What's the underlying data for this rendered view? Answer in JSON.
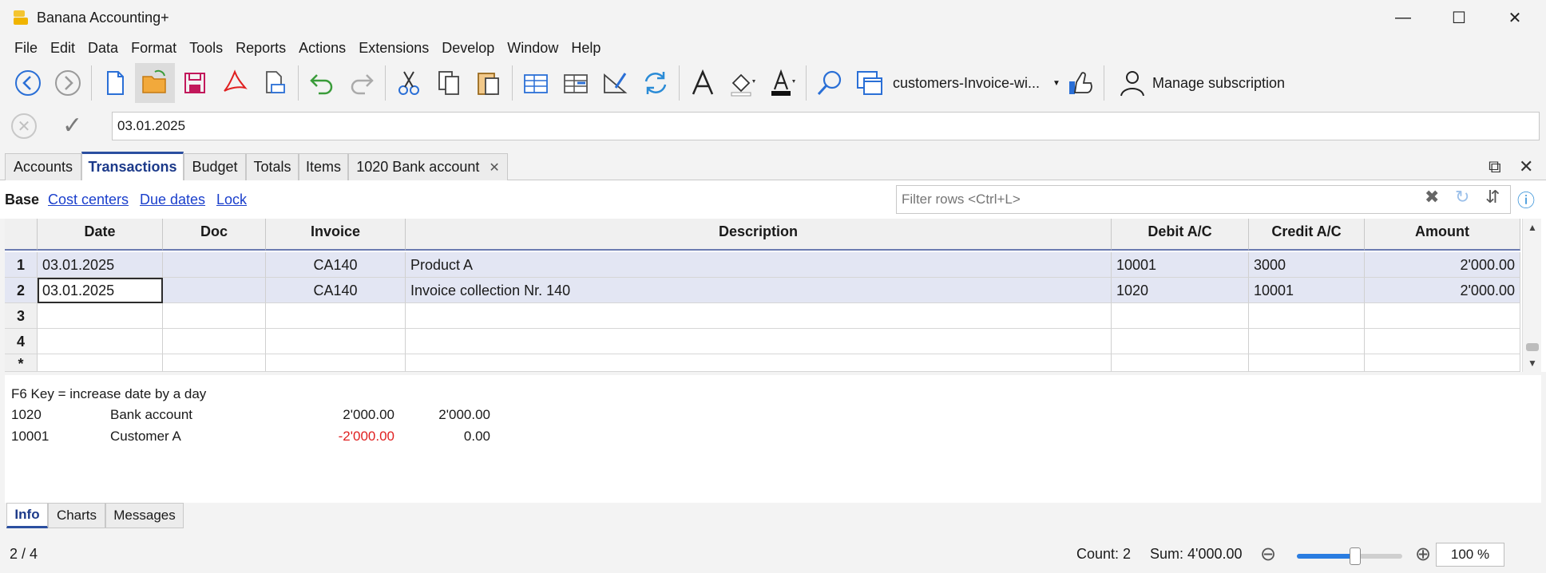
{
  "window": {
    "title": "Banana Accounting+"
  },
  "menu": [
    "File",
    "Edit",
    "Data",
    "Format",
    "Tools",
    "Reports",
    "Actions",
    "Extensions",
    "Develop",
    "Window",
    "Help"
  ],
  "toolbar": {
    "file_name": "customers-Invoice-wi...",
    "manage_label": "Manage subscription"
  },
  "editline": {
    "value": "03.01.2025"
  },
  "tabs": [
    "Accounts",
    "Transactions",
    "Budget",
    "Totals",
    "Items",
    "1020 Bank account"
  ],
  "active_tab": "Transactions",
  "views": [
    "Base",
    "Cost centers",
    "Due dates",
    "Lock"
  ],
  "filter": {
    "placeholder": "Filter rows <Ctrl+L>"
  },
  "table": {
    "columns": [
      "Date",
      "Doc",
      "Invoice",
      "Description",
      "Debit A/C",
      "Credit A/C",
      "Amount"
    ],
    "rows": [
      {
        "n": "1",
        "date": "03.01.2025",
        "doc": "",
        "invoice": "CA140",
        "description": "Product A",
        "debit": "10001",
        "credit": "3000",
        "amount": "2'000.00"
      },
      {
        "n": "2",
        "date": "03.01.2025",
        "doc": "",
        "invoice": "CA140",
        "description": "Invoice collection Nr. 140",
        "debit": "1020",
        "credit": "10001",
        "amount": "2'000.00"
      },
      {
        "n": "3",
        "date": "",
        "doc": "",
        "invoice": "",
        "description": "",
        "debit": "",
        "credit": "",
        "amount": ""
      },
      {
        "n": "4",
        "date": "",
        "doc": "",
        "invoice": "",
        "description": "",
        "debit": "",
        "credit": "",
        "amount": ""
      },
      {
        "n": "*",
        "date": "",
        "doc": "",
        "invoice": "",
        "description": "",
        "debit": "",
        "credit": "",
        "amount": ""
      }
    ]
  },
  "info": {
    "hint": "F6 Key = increase date by a day",
    "accounts": [
      {
        "account": "1020",
        "name": "Bank account",
        "v1": "2'000.00",
        "v2": "2'000.00"
      },
      {
        "account": "10001",
        "name": "Customer A",
        "v1": "-2'000.00",
        "v2": "0.00"
      }
    ]
  },
  "bottom_tabs": [
    "Info",
    "Charts",
    "Messages"
  ],
  "status": {
    "position": "2 / 4",
    "count": "Count: 2",
    "sum": "Sum: 4'000.00",
    "zoom": "100 %",
    "zoom_level": 0.55
  },
  "colors": {
    "accent": "#2b4fa0",
    "selection": "#e3e6f3",
    "negative": "#e02020",
    "link": "#1a3fcc"
  }
}
